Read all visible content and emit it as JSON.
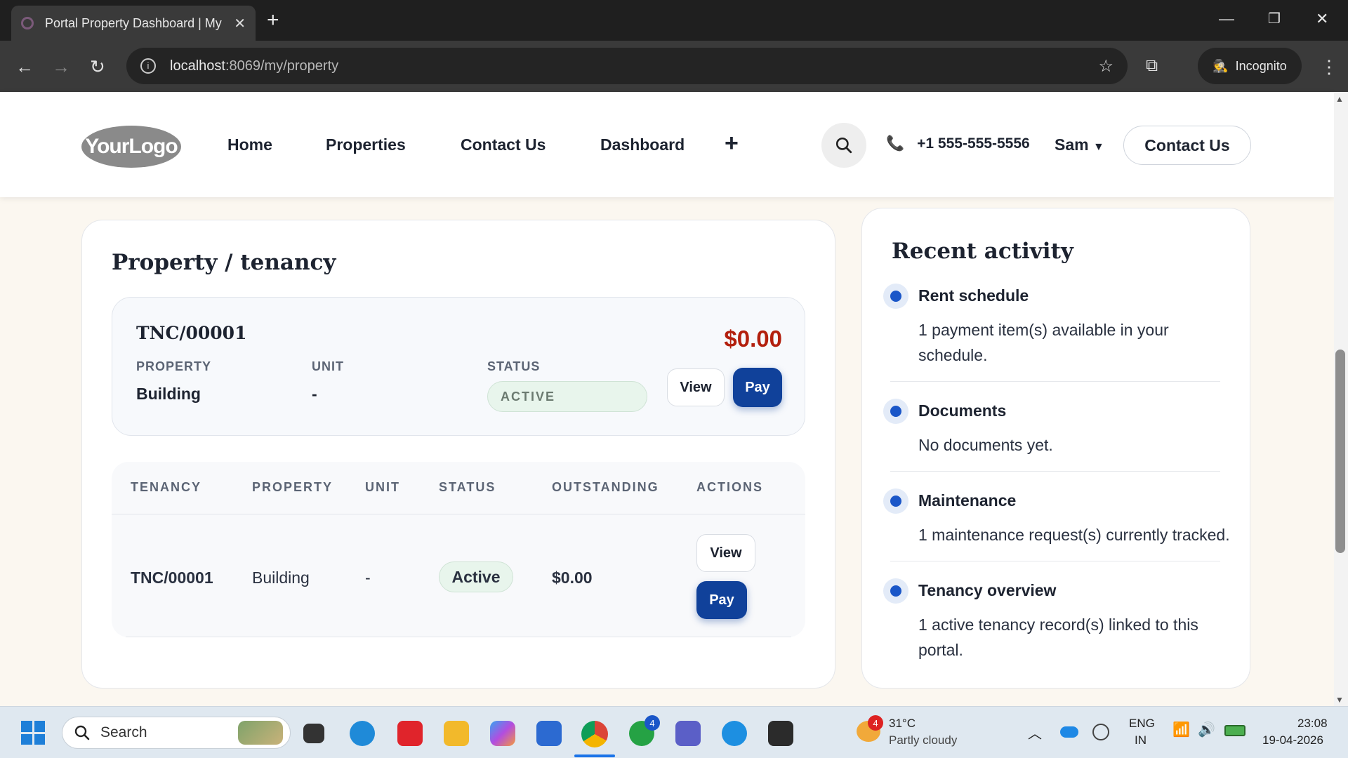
{
  "browser": {
    "tab_title": "Portal Property Dashboard | My",
    "url_host": "localhost",
    "url_path": ":8069/my/property",
    "incognito_label": "Incognito"
  },
  "header": {
    "logo_text": "YourLogo",
    "nav": [
      "Home",
      "Properties",
      "Contact Us",
      "Dashboard"
    ],
    "phone": "+1 555-555-5556",
    "user": "Sam",
    "contact_button": "Contact Us"
  },
  "tenancy_card": {
    "title": "Property / tenancy",
    "ref": "TNC/00001",
    "amount": "$0.00",
    "labels": {
      "property": "PROPERTY",
      "unit": "UNIT",
      "status": "STATUS"
    },
    "property": "Building",
    "unit": "-",
    "status": "ACTIVE",
    "view_label": "View",
    "pay_label": "Pay"
  },
  "table": {
    "headers": [
      "TENANCY",
      "PROPERTY",
      "UNIT",
      "STATUS",
      "OUTSTANDING",
      "ACTIONS"
    ],
    "rows": [
      {
        "tenancy": "TNC/00001",
        "property": "Building",
        "unit": "-",
        "status": "Active",
        "outstanding": "$0.00",
        "view": "View",
        "pay": "Pay"
      }
    ]
  },
  "activity": {
    "title": "Recent activity",
    "items": [
      {
        "title": "Rent schedule",
        "desc": "1 payment item(s) available in your schedule."
      },
      {
        "title": "Documents",
        "desc": "No documents yet."
      },
      {
        "title": "Maintenance",
        "desc": "1 maintenance request(s) currently tracked."
      },
      {
        "title": "Tenancy overview",
        "desc": "1 active tenancy record(s) linked to this portal."
      }
    ]
  },
  "taskbar": {
    "search_placeholder": "Search",
    "whatsapp_badge": "4",
    "weather_badge": "4",
    "temperature": "31°C",
    "weather": "Partly cloudy",
    "lang1": "ENG",
    "lang2": "IN",
    "time": "23:08",
    "date": "19-04-2026"
  },
  "colors": {
    "accent": "#10419a",
    "amount": "#b3200e",
    "status_bg": "#e8f5ec",
    "dot": "#1a56c8"
  }
}
